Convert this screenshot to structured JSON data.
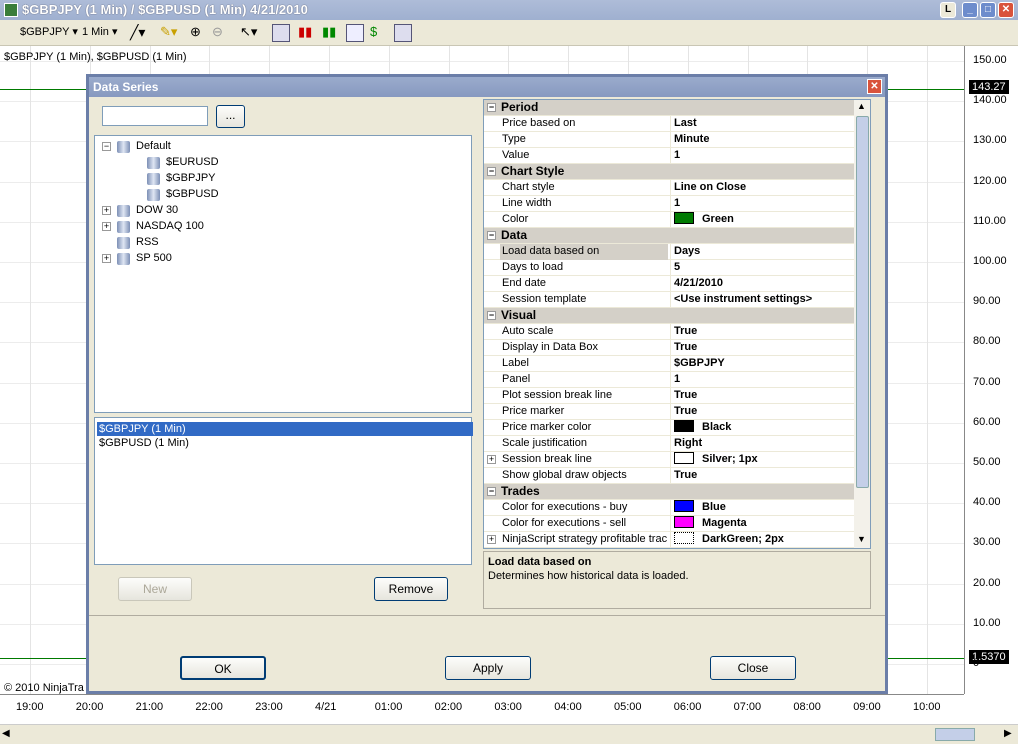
{
  "window": {
    "title": "$GBPJPY (1 Min) / $GBPUSD (1 Min)  4/21/2010"
  },
  "toolbar": {
    "instrument": "$GBPJPY",
    "interval": "1 Min"
  },
  "chart": {
    "label": "$GBPJPY (1 Min), $GBPUSD (1 Min)",
    "copyright": "© 2010 NinjaTra",
    "y_labels": [
      "150.00",
      "140.00",
      "130.00",
      "120.00",
      "110.00",
      "100.00",
      "90.00",
      "80.00",
      "70.00",
      "60.00",
      "50.00",
      "40.00",
      "30.00",
      "20.00",
      "10.00",
      "0"
    ],
    "x_labels": [
      "19:00",
      "20:00",
      "21:00",
      "22:00",
      "23:00",
      "4/21",
      "01:00",
      "02:00",
      "03:00",
      "04:00",
      "05:00",
      "06:00",
      "07:00",
      "08:00",
      "09:00",
      "10:00"
    ],
    "price_marker_top": "143.27",
    "price_marker_bottom": "1.5370",
    "line_color": "#007a00"
  },
  "dialog": {
    "title": "Data Series",
    "search_value": "",
    "browse_label": "...",
    "tree": [
      {
        "label": "Default",
        "expanded": true
      },
      {
        "label": "$EURUSD"
      },
      {
        "label": "$GBPJPY"
      },
      {
        "label": "$GBPUSD"
      },
      {
        "label": "DOW 30"
      },
      {
        "label": "NASDAQ 100"
      },
      {
        "label": "RSS"
      },
      {
        "label": "SP 500"
      }
    ],
    "series": [
      "$GBPJPY (1 Min)",
      "$GBPUSD (1 Min)"
    ],
    "new_label": "New",
    "remove_label": "Remove",
    "ok_label": "OK",
    "apply_label": "Apply",
    "close_label": "Close",
    "props": [
      {
        "cat": "Period"
      },
      {
        "name": "Price based on",
        "value": "Last"
      },
      {
        "name": "Type",
        "value": "Minute"
      },
      {
        "name": "Value",
        "value": "1"
      },
      {
        "cat": "Chart Style"
      },
      {
        "name": "Chart style",
        "value": "Line on Close"
      },
      {
        "name": "Line width",
        "value": "1"
      },
      {
        "name": "Color",
        "value": "Green",
        "swatch": "#007a00"
      },
      {
        "cat": "Data"
      },
      {
        "name": "Load data based on",
        "value": "Days",
        "selected": true
      },
      {
        "name": "Days to load",
        "value": "5"
      },
      {
        "name": "End date",
        "value": "4/21/2010"
      },
      {
        "name": "Session template",
        "value": "<Use instrument settings>"
      },
      {
        "cat": "Visual"
      },
      {
        "name": "Auto scale",
        "value": "True"
      },
      {
        "name": "Display in Data Box",
        "value": "True"
      },
      {
        "name": "Label",
        "value": "$GBPJPY"
      },
      {
        "name": "Panel",
        "value": "1"
      },
      {
        "name": "Plot session break line",
        "value": "True"
      },
      {
        "name": "Price marker",
        "value": "True"
      },
      {
        "name": "Price marker color",
        "value": "Black",
        "swatch": "#000000"
      },
      {
        "name": "Scale justification",
        "value": "Right"
      },
      {
        "name": "Session break line",
        "value": "Silver; 1px",
        "swatch": "#ffffff",
        "expand": true
      },
      {
        "name": "Show global draw objects",
        "value": "True"
      },
      {
        "cat": "Trades"
      },
      {
        "name": "Color for executions - buy",
        "value": "Blue",
        "swatch": "#0000ff"
      },
      {
        "name": "Color for executions - sell",
        "value": "Magenta",
        "swatch": "#ff00ff"
      },
      {
        "name": "NinjaScript strategy profitable trac",
        "value": "DarkGreen; 2px",
        "swatch": "#ffffff",
        "dotted": true,
        "expand": true
      }
    ],
    "description_title": "Load data based on",
    "description_text": "Determines how historical data is loaded."
  }
}
